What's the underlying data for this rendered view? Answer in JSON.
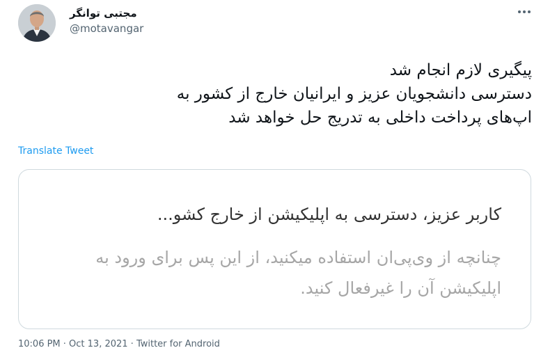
{
  "author": {
    "display_name": "مجتبی توانگر",
    "handle": "@motavangar",
    "avatar_icon": "profile-photo"
  },
  "tweet": {
    "lines": [
      "پیگیری لازم انجام شد",
      "دسترسی دانشجویان عزیز و ایرانیان خارج از کشور به",
      "اپ‌های پرداخت داخلی به تدریج حل خواهد شد"
    ],
    "translate_label": "Translate Tweet",
    "more_icon": "more-dots-icon"
  },
  "media": {
    "title": "کاربر عزیز، دسترسی به اپلیکیشن    از خارج کشو...",
    "subtitle_lines": [
      "چنانچه از وی‌پی‌ان استفاده میکنید، از این پس برای ورود به",
      "اپلیکیشن آن را غیرفعال کنید."
    ]
  },
  "meta": {
    "timestamp": "10:06 PM · Oct 13, 2021 · Twitter for Android"
  },
  "colors": {
    "link": "#1d9bf0",
    "secondary_text": "#536471",
    "border": "#cfd9de"
  }
}
